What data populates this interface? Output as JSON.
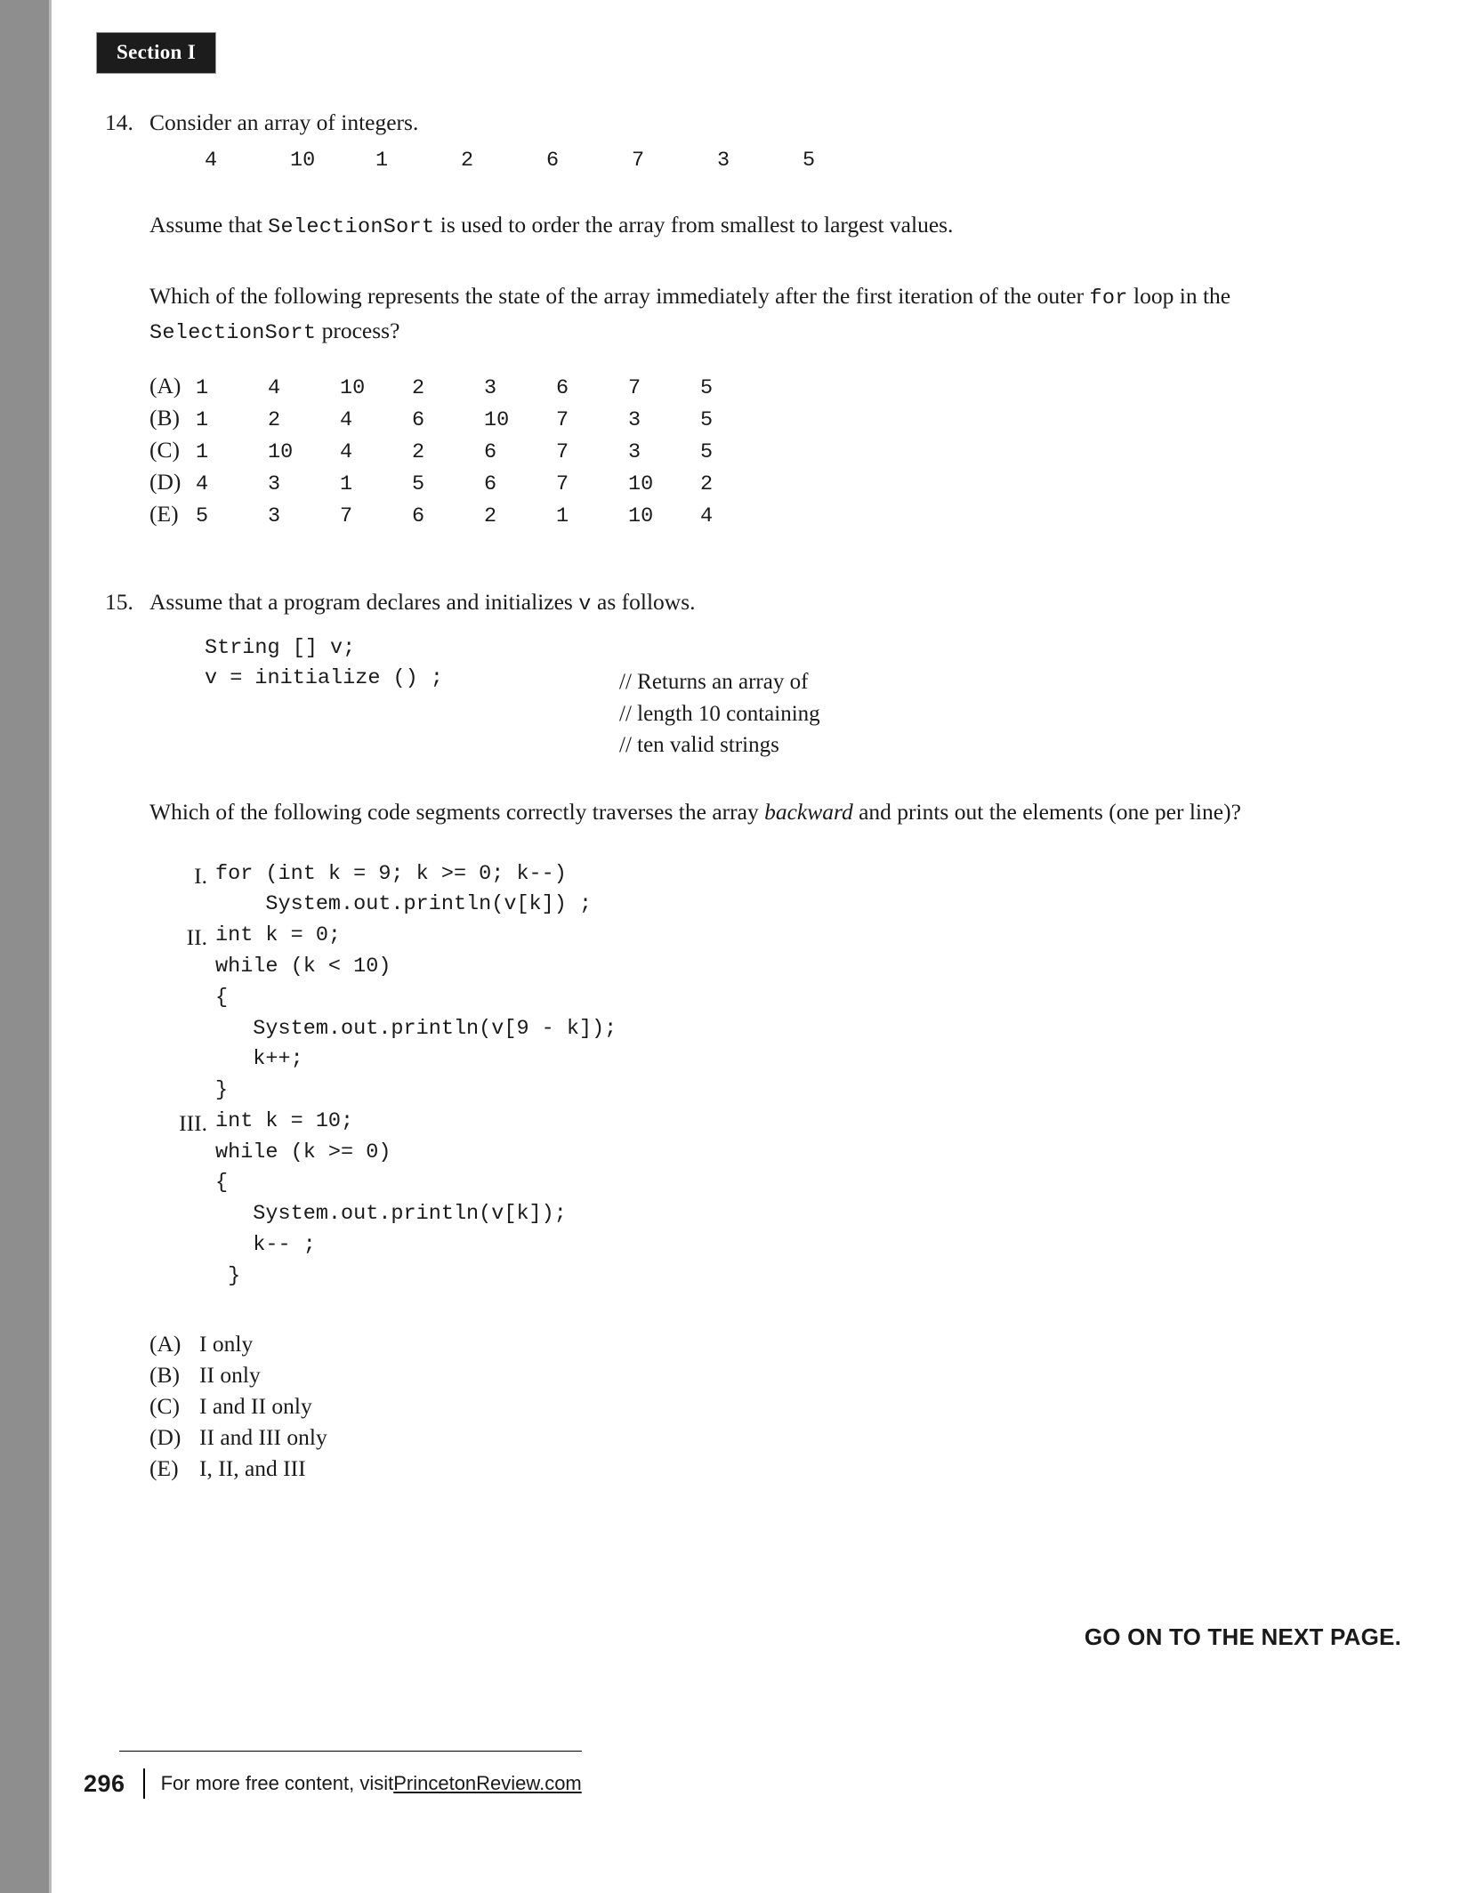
{
  "section_tab": "Section I",
  "questions": [
    {
      "number": "14.",
      "stem": "Consider an array of integers.",
      "array_values": [
        "4",
        "10",
        "1",
        "2",
        "6",
        "7",
        "3",
        "5"
      ],
      "para1_pre": "Assume that ",
      "para1_code": "SelectionSort",
      "para1_post": " is used to order the array from smallest to largest values.",
      "para2_pre": "Which of the following represents the state of the array immediately after the first iteration of the outer ",
      "para2_code1": "for",
      "para2_mid": " loop in the ",
      "para2_code2": "SelectionSort",
      "para2_post": " process?",
      "choices": [
        {
          "label": "(A)",
          "values": [
            "1",
            "4",
            "10",
            "2",
            "3",
            "6",
            "7",
            "5"
          ]
        },
        {
          "label": "(B)",
          "values": [
            "1",
            "2",
            "4",
            "6",
            "10",
            "7",
            "3",
            "5"
          ]
        },
        {
          "label": "(C)",
          "values": [
            "1",
            "10",
            "4",
            "2",
            "6",
            "7",
            "3",
            "5"
          ]
        },
        {
          "label": "(D)",
          "values": [
            "4",
            "3",
            "1",
            "5",
            "6",
            "7",
            "10",
            "2"
          ]
        },
        {
          "label": "(E)",
          "values": [
            "5",
            "3",
            "7",
            "6",
            "2",
            "1",
            "10",
            "4"
          ]
        }
      ]
    },
    {
      "number": "15.",
      "stem_pre": "Assume that a program declares and initializes ",
      "stem_code": "v",
      "stem_post": " as follows.",
      "code_line1": "String [] v;",
      "code_line2": "v = initialize () ;",
      "comments": [
        "// Returns an array of",
        "// length 10 containing",
        "// ten valid strings"
      ],
      "para_pre": "Which of the following code segments correctly traverses the array ",
      "para_italic": "backward",
      "para_post": " and prints out the elements (one per line)?",
      "segments": [
        {
          "numeral": "I.",
          "code": "for (int k = 9; k >= 0; k--)\n    System.out.println(v[k]) ;"
        },
        {
          "numeral": "II.",
          "code": "int k = 0;\nwhile (k < 10)\n{\n   System.out.println(v[9 - k]);\n   k++;\n}"
        },
        {
          "numeral": "III.",
          "code": "int k = 10;\nwhile (k >= 0)\n{\n   System.out.println(v[k]);\n   k-- ;\n }"
        }
      ],
      "choices": [
        {
          "label": "(A)",
          "text": "I only"
        },
        {
          "label": "(B)",
          "text": "II only"
        },
        {
          "label": "(C)",
          "text": "I and II only"
        },
        {
          "label": "(D)",
          "text": "II and III only"
        },
        {
          "label": "(E)",
          "text": "I, II, and III"
        }
      ]
    }
  ],
  "go_on_notice": "GO ON TO THE NEXT PAGE.",
  "footer": {
    "page_number": "296",
    "text": "For more free content, visit ",
    "link": "PrincetonReview.com"
  }
}
